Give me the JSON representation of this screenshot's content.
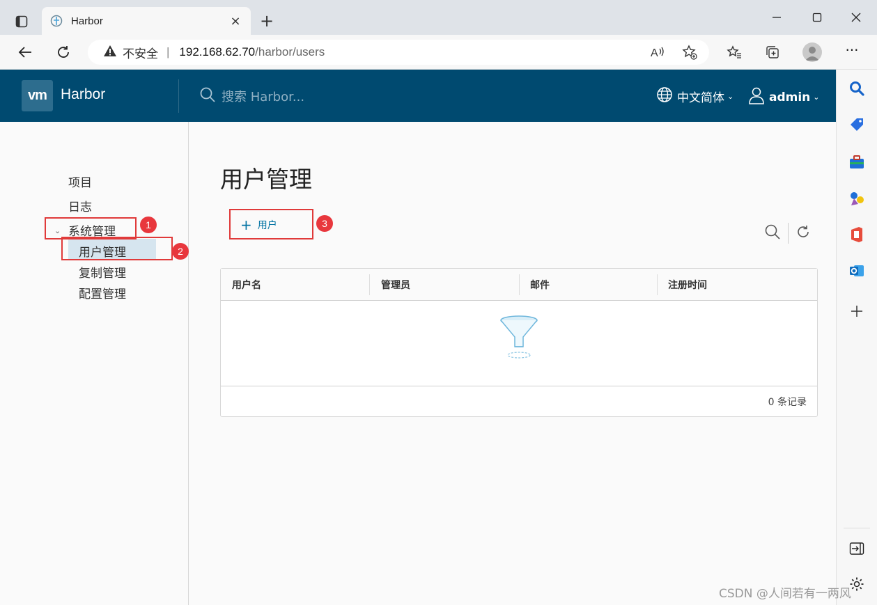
{
  "browser": {
    "tab_title": "Harbor",
    "tab_close": "×",
    "new_tab": "+",
    "security_label": "不安全",
    "url_separator": "|",
    "url_host": "192.168.62.70",
    "url_path": "/harbor/users",
    "more_menu": "···"
  },
  "header": {
    "logo_text": "vm",
    "brand": "Harbor",
    "search_placeholder": "搜索 Harbor...",
    "language": "中文简体",
    "user": "admin",
    "caret": "⌄"
  },
  "sidebar": {
    "items": [
      {
        "label": "项目"
      },
      {
        "label": "日志"
      },
      {
        "label": "系统管理"
      }
    ],
    "sub_items": [
      {
        "label": "用户管理"
      },
      {
        "label": "复制管理"
      },
      {
        "label": "配置管理"
      }
    ],
    "expand_icon": "⌄"
  },
  "main": {
    "title": "用户管理",
    "add_user_plus": "+",
    "add_user_label": "用户",
    "columns": [
      "用户名",
      "管理员",
      "邮件",
      "注册时间"
    ],
    "footer": "0 条记录"
  },
  "annotations": [
    "1",
    "2",
    "3"
  ],
  "watermark": "CSDN @人间若有一两风",
  "colors": {
    "header_bg": "#004a70",
    "accent": "#0072a3",
    "annotation": "#e03a3a",
    "active_nav": "#d6e5ef"
  }
}
